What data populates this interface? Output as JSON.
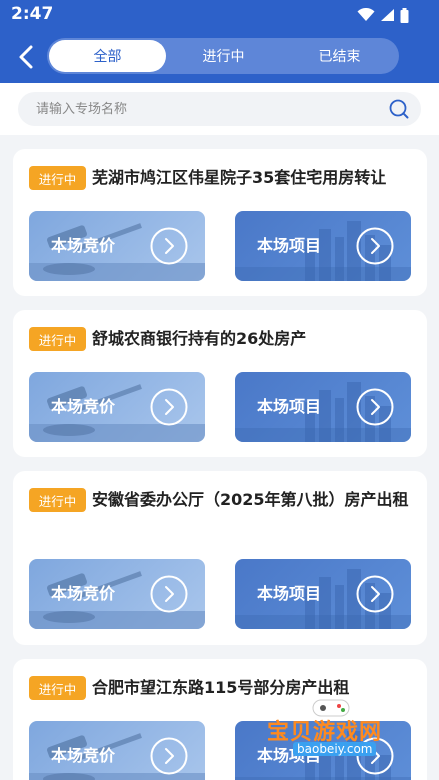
{
  "status_bar": {
    "time": "2:47"
  },
  "header": {
    "back_icon": "chevron-left-icon",
    "tabs": [
      {
        "label": "全部",
        "active": true
      },
      {
        "label": "进行中",
        "active": false
      },
      {
        "label": "已结束",
        "active": false
      }
    ]
  },
  "search": {
    "placeholder": "请输入专场名称",
    "value": ""
  },
  "sessions": [
    {
      "status": "进行中",
      "title": "芜湖市鸠江区伟星院子35套住宅用房转让",
      "bid_label": "本场竞价",
      "project_label": "本场项目"
    },
    {
      "status": "进行中",
      "title": "舒城农商银行持有的26处房产",
      "bid_label": "本场竞价",
      "project_label": "本场项目"
    },
    {
      "status": "进行中",
      "title": "安徽省委办公厅（2025年第八批）房产出租",
      "bid_label": "本场竞价",
      "project_label": "本场项目"
    },
    {
      "status": "进行中",
      "title": "合肥市望江东路115号部分房产出租",
      "bid_label": "本场竞价",
      "project_label": "本场项目"
    }
  ],
  "watermark": {
    "text": "宝贝游戏网",
    "url": "baobeiy.com"
  },
  "colors": {
    "primary": "#2d61c9",
    "badge": "#f5a524",
    "background": "#f2f4f7"
  }
}
